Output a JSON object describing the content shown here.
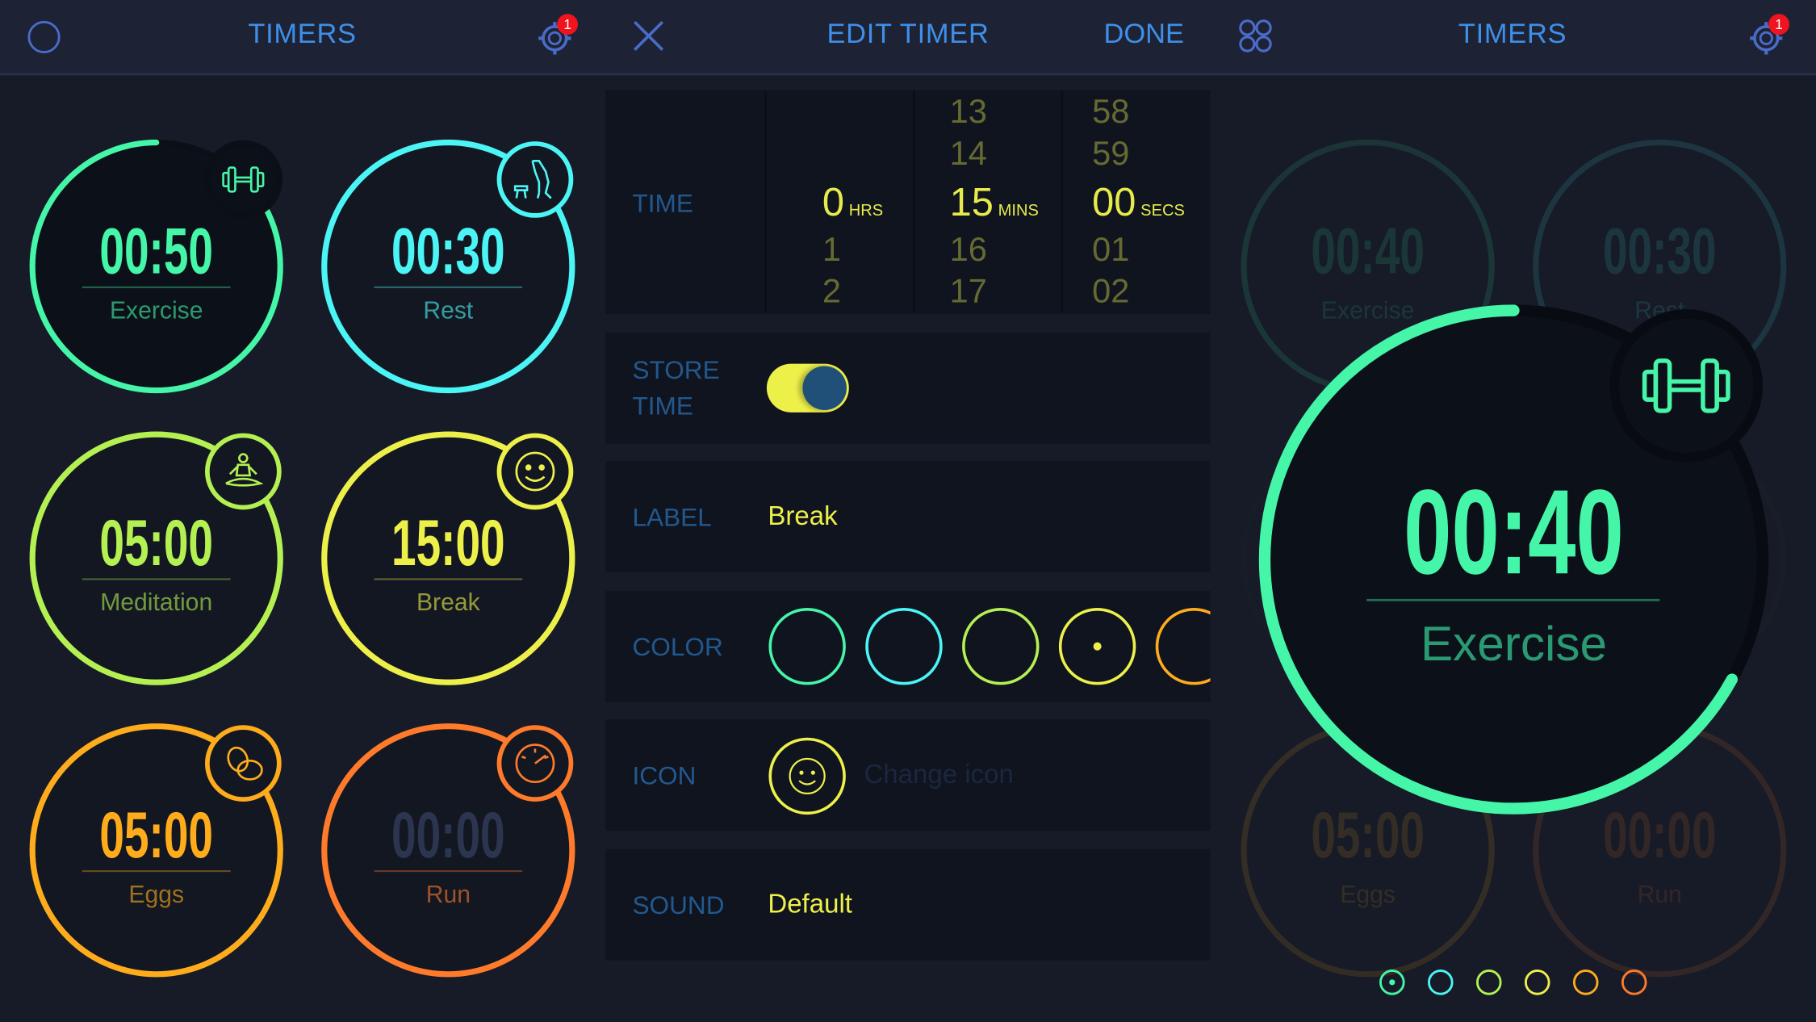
{
  "colors": {
    "green": "#45f5a8",
    "cyan": "#4cf5f5",
    "lime": "#b4f052",
    "yellow": "#eef04a",
    "orange": "#ffac1c",
    "red_orange": "#ff7a2a",
    "accent": "#3f8fe8",
    "label_blue": "#23588e"
  },
  "left_panel": {
    "title": "TIMERS",
    "left_icon": "circle-icon",
    "settings_icon": "gear-icon",
    "notification_count": "1",
    "timers": [
      {
        "time": "00:50",
        "label": "Exercise",
        "color": "#45f5a8",
        "icon": "dumbbell",
        "progress": 0.83,
        "selected": true
      },
      {
        "time": "00:30",
        "label": "Rest",
        "color": "#4cf5f5",
        "icon": "bench-tree",
        "progress": 1
      },
      {
        "time": "05:00",
        "label": "Meditation",
        "color": "#b4f052",
        "icon": "meditation",
        "progress": 1
      },
      {
        "time": "15:00",
        "label": "Break",
        "color": "#eef04a",
        "icon": "smiley",
        "progress": 1
      },
      {
        "time": "05:00",
        "label": "Eggs",
        "color": "#ffac1c",
        "icon": "eggs",
        "progress": 1
      },
      {
        "time": "00:00",
        "label": "Run",
        "color": "#ff7a2a",
        "icon": "speedometer",
        "progress": 1,
        "time_dimmed": true
      }
    ]
  },
  "edit_panel": {
    "close_icon": "close-icon",
    "title": "EDIT TIMER",
    "done_label": "DONE",
    "time": {
      "label": "TIME",
      "hours": {
        "above": [],
        "selected": "0",
        "unit": "HRS",
        "below": [
          "1",
          "2"
        ]
      },
      "minutes": {
        "above": [
          "13",
          "14"
        ],
        "selected": "15",
        "unit": "MINS",
        "below": [
          "16",
          "17"
        ]
      },
      "seconds": {
        "above": [
          "58",
          "59"
        ],
        "selected": "00",
        "unit": "SECS",
        "below": [
          "01",
          "02"
        ]
      }
    },
    "store_time": {
      "label_line1": "STORE",
      "label_line2": "TIME",
      "on": true
    },
    "label": {
      "label": "LABEL",
      "value": "Break"
    },
    "color": {
      "label": "COLOR",
      "options": [
        "#45f5a8",
        "#4cf5f5",
        "#b4f052",
        "#eef04a",
        "#ffac1c"
      ],
      "selected_index": 3
    },
    "icon": {
      "label": "ICON",
      "current": "smiley",
      "change_label": "Change icon"
    },
    "sound": {
      "label": "SOUND",
      "value": "Default"
    }
  },
  "right_panel": {
    "grid_icon": "grid-icon",
    "title": "TIMERS",
    "settings_icon": "gear-icon",
    "notification_count": "1",
    "active_timer": {
      "time": "00:40",
      "label": "Exercise",
      "color": "#45f5a8",
      "icon": "dumbbell",
      "progress": 0.67
    },
    "background_timers": [
      {
        "time": "00:40",
        "label": "Exercise",
        "color": "#45f5a8"
      },
      {
        "time": "00:30",
        "label": "Rest",
        "color": "#4cf5f5"
      },
      {
        "time": "05:00",
        "label": "Eggs",
        "color": "#ffac1c"
      },
      {
        "time": "00:00",
        "label": "Run",
        "color": "#ff7a2a"
      }
    ],
    "page_dots": [
      "#45f5a8",
      "#4cf5f5",
      "#b4f052",
      "#eef04a",
      "#ffac1c",
      "#ff7a2a"
    ],
    "active_page": 0
  }
}
